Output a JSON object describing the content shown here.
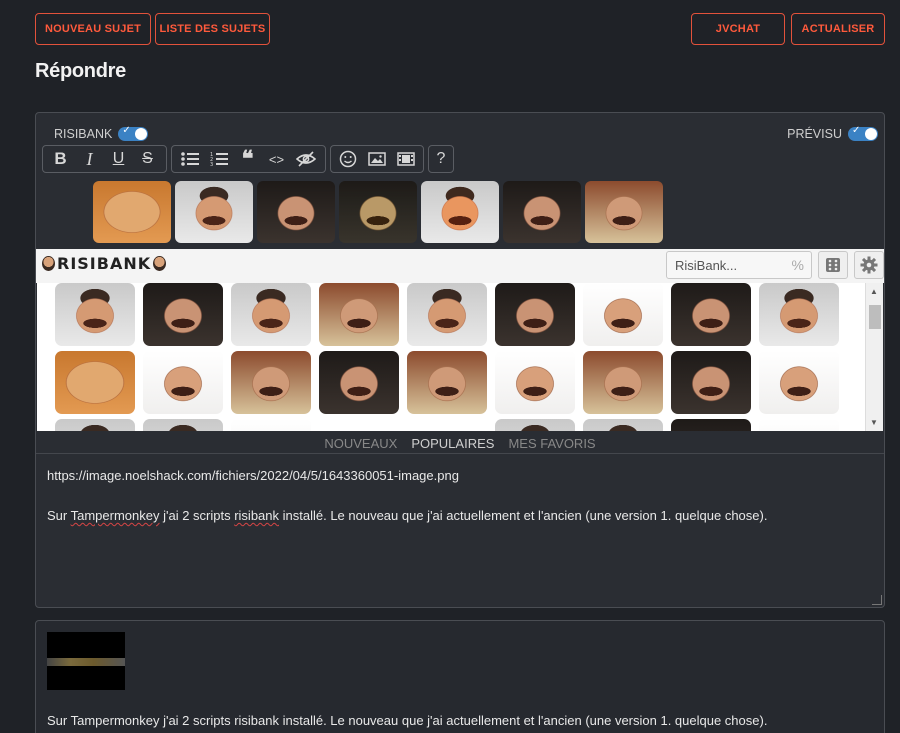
{
  "header": {
    "new_topic": "NOUVEAU SUJET",
    "topic_list": "LISTE DES SUJETS",
    "jvchat": "JVCHAT",
    "refresh": "ACTUALISER"
  },
  "page_title": "Répondre",
  "editor": {
    "risibank_toggle_label": "RISIBANK",
    "risibank_toggle_on": true,
    "preview_toggle_label": "PRÉVISU",
    "preview_toggle_on": true,
    "toolbar": {
      "bold": "B",
      "italic": "I",
      "underline": "U",
      "strike": "S",
      "bullet_list": "bullet-list-icon",
      "numbered_list": "numbered-list-icon",
      "quote": "❝",
      "code": "<>",
      "spoiler": "eye-slash-icon",
      "smiley": "smiley-icon",
      "image": "image-icon",
      "video": "video-icon",
      "help": "?"
    },
    "risibank": {
      "logo": "RISIBANK",
      "search_placeholder": "RisiBank...",
      "search_suffix": "%",
      "tabs": [
        "NOUVEAUX",
        "POPULAIRES",
        "MES FAVORIS"
      ],
      "active_tab": "POPULAIRES"
    },
    "content_line1": "https://image.noelshack.com/fichiers/2022/04/5/1643360051-image.png",
    "content_line2_before": "Sur ",
    "content_line2_word1": "Tampermonkey",
    "content_line2_mid": " j'ai 2 scripts ",
    "content_line2_word2": "risibank",
    "content_line2_after": " installé. Le nouveau que j'ai actuellement et l'ancien (une version 1. quelque chose)."
  },
  "preview": {
    "text": "Sur Tampermonkey j'ai 2 scripts risibank installé. Le nouveau que j'ai actuellement et l'ancien (une version 1. quelque chose)."
  },
  "colors": {
    "accent": "#ff5a3c",
    "background": "#1f2227",
    "panel": "#2a2d33",
    "toggle": "#3b82c4"
  }
}
